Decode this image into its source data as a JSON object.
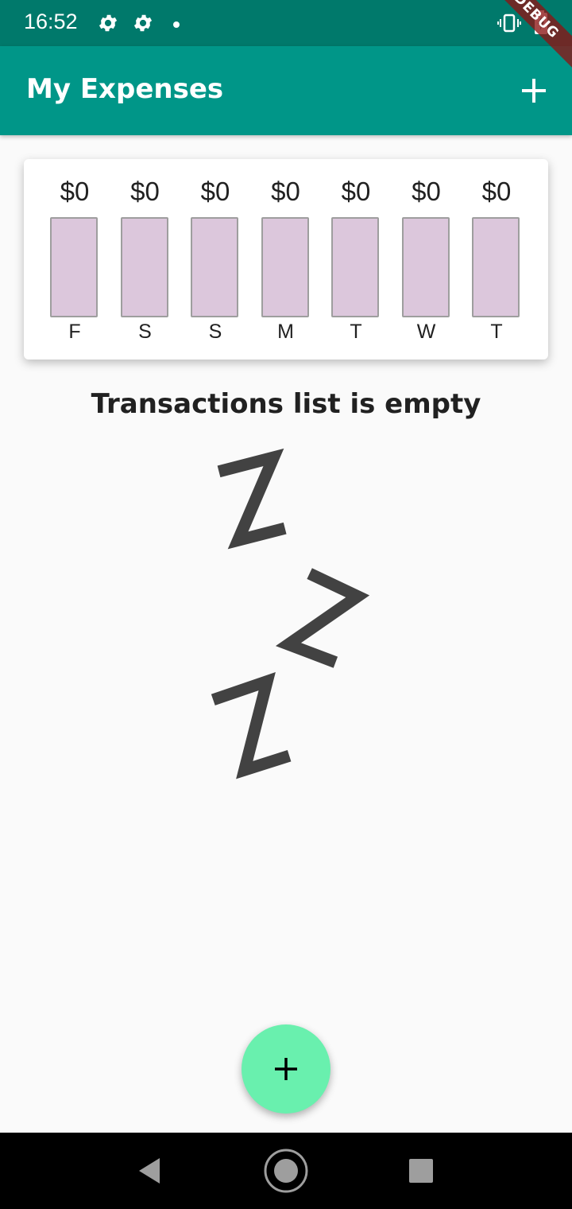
{
  "status_bar": {
    "time": "16:52",
    "icons": [
      "gear-icon",
      "gear-icon",
      "notification-dot-icon",
      "vibrate-icon",
      "battery-charging-icon"
    ]
  },
  "debug_banner": "DEBUG",
  "app_bar": {
    "title": "My Expenses",
    "action_icon": "add-icon"
  },
  "colors": {
    "status_bar": "#00796b",
    "app_bar": "#009688",
    "bar_track": "#dcc7dc",
    "fab": "#69f0ae"
  },
  "chart_data": {
    "type": "bar",
    "categories": [
      "F",
      "S",
      "S",
      "M",
      "T",
      "W",
      "T"
    ],
    "values": [
      0,
      0,
      0,
      0,
      0,
      0,
      0
    ],
    "value_labels": [
      "$0",
      "$0",
      "$0",
      "$0",
      "$0",
      "$0",
      "$0"
    ]
  },
  "empty_state": {
    "message": "Transactions list is empty",
    "image": "zzz-sleep-image"
  },
  "fab": {
    "icon": "add-icon"
  },
  "nav": {
    "icons": [
      "back-icon",
      "home-icon",
      "recents-icon"
    ]
  }
}
